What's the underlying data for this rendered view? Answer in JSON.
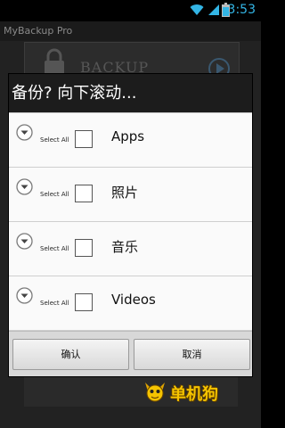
{
  "status_bar": {
    "time": "3:53",
    "icons": [
      "wifi-icon",
      "signal-icon",
      "battery-icon"
    ],
    "accent": "#33b5e5"
  },
  "app": {
    "title": "MyBackup Pro",
    "card_label": "BACKUP",
    "icons": [
      "lock-icon",
      "play-icon"
    ]
  },
  "dialog": {
    "title": "备份? 向下滚动...",
    "groups": [
      {
        "select_all": "Select All",
        "label": "Apps",
        "checked": false
      },
      {
        "select_all": "Select All",
        "label": "照片",
        "checked": false
      },
      {
        "select_all": "Select All",
        "label": "音乐",
        "checked": false
      },
      {
        "select_all": "Select All",
        "label": "Videos",
        "checked": false
      }
    ],
    "confirm_label": "确认",
    "cancel_label": "取消"
  },
  "watermark": {
    "text": "单机狗"
  }
}
